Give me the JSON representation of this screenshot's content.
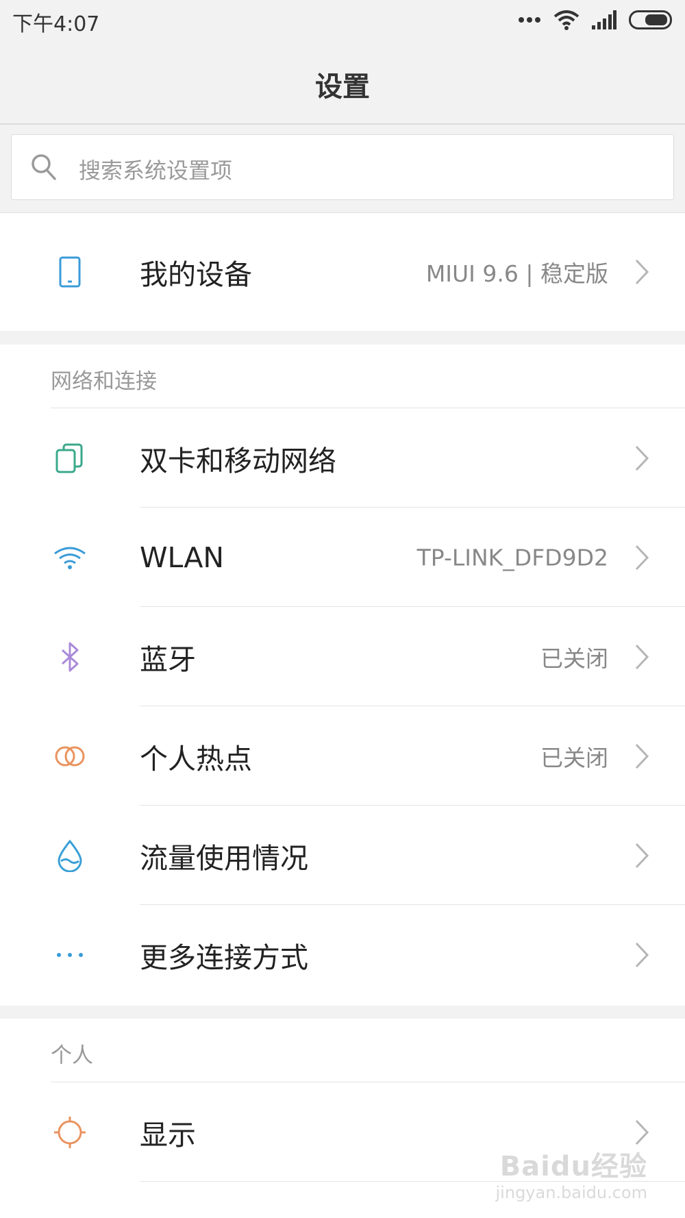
{
  "status_bar": {
    "time": "下午4:07",
    "icons": [
      "more-dots-icon",
      "wifi-icon",
      "signal-icon",
      "battery-icon"
    ]
  },
  "header": {
    "title": "设置"
  },
  "search": {
    "placeholder": "搜索系统设置项",
    "icon": "search-icon"
  },
  "device": {
    "label": "我的设备",
    "value": "MIUI 9.6 | 稳定版",
    "icon": "phone-icon"
  },
  "network_section": {
    "header": "网络和连接",
    "items": [
      {
        "label": "双卡和移动网络",
        "value": "",
        "icon": "sim-cards-icon",
        "color": "#3aa98b"
      },
      {
        "label": "WLAN",
        "value": "TP-LINK_DFD9D2",
        "icon": "wifi-icon",
        "color": "#3a9bd8"
      },
      {
        "label": "蓝牙",
        "value": "已关闭",
        "icon": "bluetooth-icon",
        "color": "#a98ad8"
      },
      {
        "label": "个人热点",
        "value": "已关闭",
        "icon": "hotspot-icon",
        "color": "#e9935f"
      },
      {
        "label": "流量使用情况",
        "value": "",
        "icon": "data-drop-icon",
        "color": "#3aa0d6"
      },
      {
        "label": "更多连接方式",
        "value": "",
        "icon": "more-dots-icon",
        "color": "#3a9bd8"
      }
    ]
  },
  "personal_section": {
    "header": "个人",
    "items": [
      {
        "label": "显示",
        "value": "",
        "icon": "brightness-icon",
        "color": "#e9935f"
      }
    ]
  },
  "watermark": {
    "logo": "Baidu经验",
    "url": "jingyan.baidu.com"
  },
  "colors": {
    "background": "#f2f2f2",
    "card": "#ffffff",
    "secondary_text": "#888888"
  }
}
